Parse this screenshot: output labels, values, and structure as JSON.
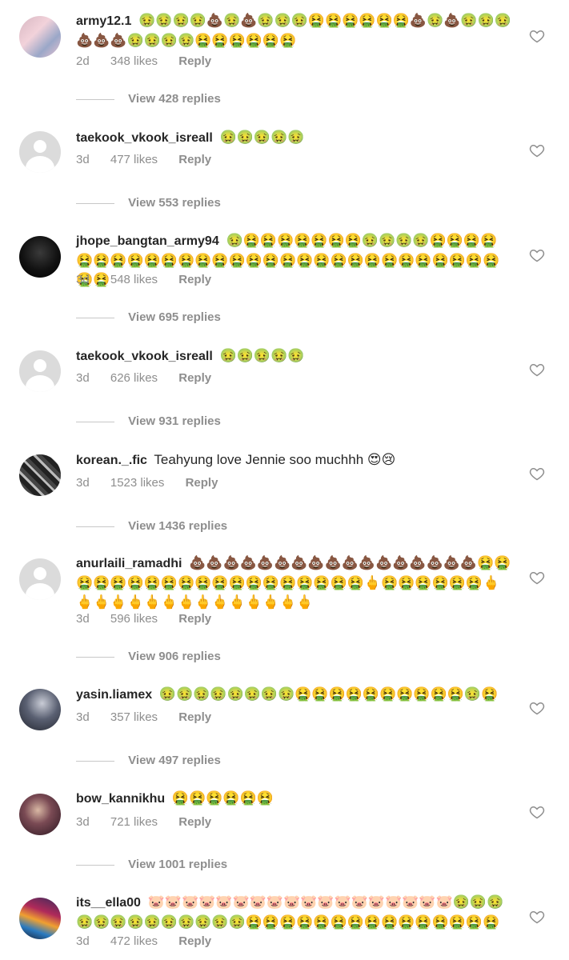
{
  "comments": [
    {
      "username": "army12.1",
      "text": "🤢🤢🤢🤢💩🤢💩🤢🤢🤢🤮🤮🤮🤮🤮🤮💩🤢💩🤢🤢🤢💩💩💩🤢🤢🤢🤢🤮🤮🤮🤮🤮🤮",
      "time": "2d",
      "likes": "348 likes",
      "reply": "Reply",
      "view_replies": "View 428 replies",
      "avatar": "photo"
    },
    {
      "username": "taekook_vkook_isreall",
      "text": "🤢🤢🤢🤢🤢",
      "time": "3d",
      "likes": "477 likes",
      "reply": "Reply",
      "view_replies": "View 553 replies",
      "avatar": "default"
    },
    {
      "username": "jhope_bangtan_army94",
      "text": "🤢🤮🤮🤮🤮🤮🤮🤮🤢🤢🤢🤢🤮🤮🤮🤮🤮🤮🤮🤮🤮🤮🤮🤮🤮🤮🤮🤮🤮🤮🤮🤮🤮🤮🤮🤮🤮🤮🤮🤮🤮🤮🤮",
      "time": "3d",
      "likes": "548 likes",
      "reply": "Reply",
      "view_replies": "View 695 replies",
      "avatar": "photo"
    },
    {
      "username": "taekook_vkook_isreall",
      "text": "🤢🤢🤢🤢🤢",
      "time": "3d",
      "likes": "626 likes",
      "reply": "Reply",
      "view_replies": "View 931 replies",
      "avatar": "default"
    },
    {
      "username": "korean._.fic",
      "text": "Teahyung love Jennie soo muchhh 😍😢",
      "time": "3d",
      "likes": "1523 likes",
      "reply": "Reply",
      "view_replies": "View 1436 replies",
      "avatar": "photo"
    },
    {
      "username": "anurlaili_ramadhi",
      "text": "💩💩💩💩💩💩💩💩💩💩💩💩💩💩💩💩💩🤮🤮🤮🤮🤮🤮🤮🤮🤮🤮🤮🤮🤮🤮🤮🤮🤮🤮🤮🖕🤮🤮🤮🤮🤮🤮🖕🖕🖕🖕🖕🖕🖕🖕🖕🖕🖕🖕🖕🖕🖕",
      "time": "3d",
      "likes": "596 likes",
      "reply": "Reply",
      "view_replies": "View 906 replies",
      "avatar": "default"
    },
    {
      "username": "yasin.liamex",
      "text": "🤢🤢🤢🤢🤢🤢🤢🤢🤮🤮🤮🤮🤮🤮🤮🤮🤮🤮🤢🤮",
      "time": "3d",
      "likes": "357 likes",
      "reply": "Reply",
      "view_replies": "View 497 replies",
      "avatar": "photo"
    },
    {
      "username": "bow_kannikhu",
      "text": "🤮🤮🤮🤮🤮🤮",
      "time": "3d",
      "likes": "721 likes",
      "reply": "Reply",
      "view_replies": "View 1001 replies",
      "avatar": "photo"
    },
    {
      "username": "its__ella00",
      "text": "🐷🐷🐷🐷🐷🐷🐷🐷🐷🐷🐷🐷🐷🐷🐷🐷🐷🐷🤢🤢🤢🤢🤢🤢🤢🤢🤢🤢🤢🤢🤢🤮🤮🤮🤮🤮🤮🤮🤮🤮🤮🤮🤮🤮🤮🤮",
      "time": "3d",
      "likes": "472 likes",
      "reply": "Reply",
      "view_replies": "",
      "avatar": "photo"
    }
  ],
  "icons": {
    "like": "heart-outline-icon"
  },
  "colors": {
    "text": "#262626",
    "muted": "#8e8e8e",
    "divider": "#c7c7c7",
    "avatar_placeholder": "#dbdbdb"
  }
}
